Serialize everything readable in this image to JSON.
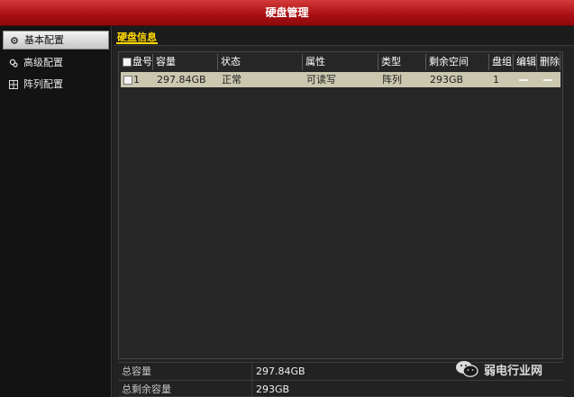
{
  "window": {
    "title": "硬盘管理"
  },
  "sidebar": {
    "items": [
      {
        "label": "基本配置",
        "icon": "gear-icon",
        "active": true
      },
      {
        "label": "高级配置",
        "icon": "gears-icon",
        "active": false
      },
      {
        "label": "阵列配置",
        "icon": "grid-icon",
        "active": false
      }
    ]
  },
  "tabs": [
    {
      "label": "硬盘信息",
      "active": true
    }
  ],
  "table": {
    "columns": [
      "盘号",
      "容量",
      "状态",
      "属性",
      "类型",
      "剩余空间",
      "盘组",
      "编辑",
      "删除"
    ],
    "rows": [
      {
        "disk_no": "1",
        "capacity": "297.84GB",
        "status": "正常",
        "attribute": "可读写",
        "type": "阵列",
        "free": "293GB",
        "group": "1"
      }
    ]
  },
  "summary": {
    "total_label": "总容量",
    "total_value": "297.84GB",
    "free_label": "总剩余容量",
    "free_value": "293GB"
  },
  "watermark": {
    "text": "弱电行业网"
  },
  "colors": {
    "title_bar": "#b31217",
    "row_highlight": "#cbc8b0",
    "tab_accent": "#ffd800"
  }
}
